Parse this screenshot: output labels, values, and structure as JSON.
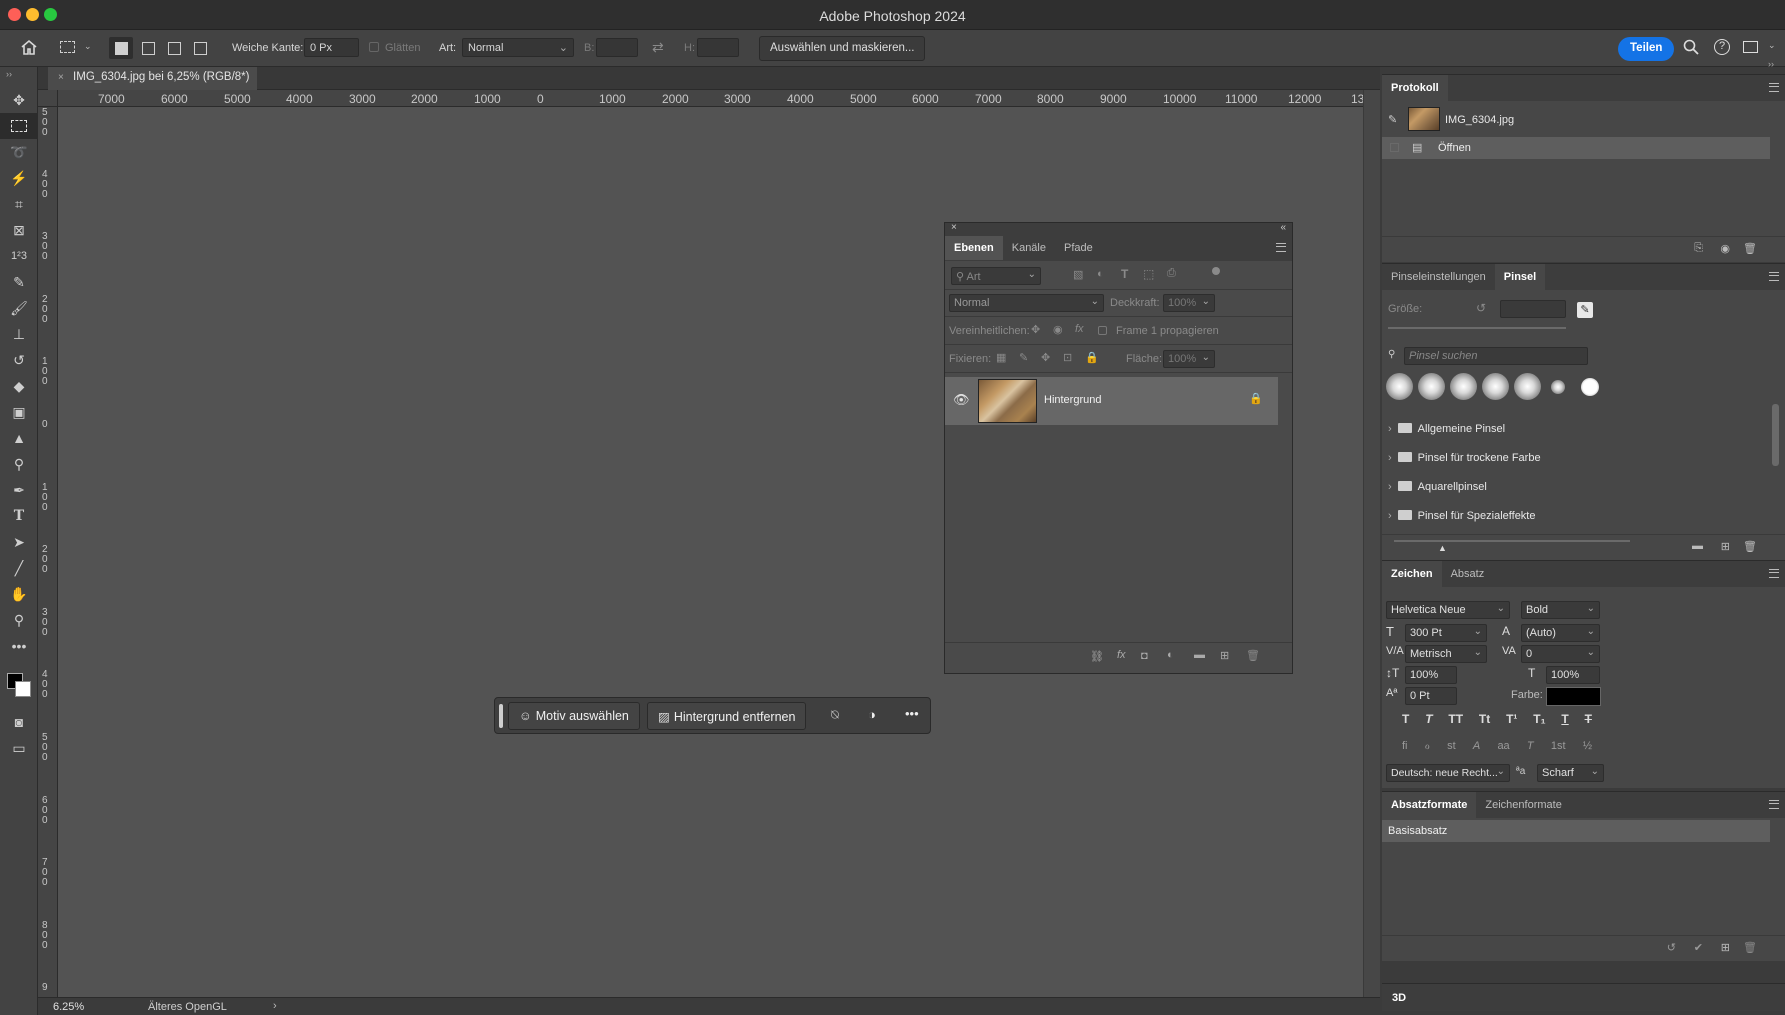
{
  "titlebar": {
    "title": "Adobe Photoshop 2024",
    "close_color": "#fe5f57",
    "minimize_color": "#febc2e",
    "zoom_color": "#28c840"
  },
  "options": {
    "feather_label": "Weiche Kante:",
    "feather_value": "0 Px",
    "antialias_label": "Glätten",
    "style_label": "Art:",
    "style_value": "Normal",
    "width_label": "B:",
    "height_label": "H:",
    "select_mask_button": "Auswählen und maskieren...",
    "share_button": "Teilen"
  },
  "document": {
    "tab_title": "IMG_6304.jpg bei 6,25% (RGB/8*)"
  },
  "ruler_h": [
    "7000",
    "6000",
    "5000",
    "4000",
    "3000",
    "2000",
    "1000",
    "0",
    "1000",
    "2000",
    "3000",
    "4000",
    "5000",
    "6000",
    "7000",
    "8000",
    "9000",
    "10000",
    "11000",
    "12000",
    "13"
  ],
  "ruler_v": [
    "5\n0\n0",
    "4\n0\n0",
    "3\n0\n0",
    "2\n0\n0",
    "1\n0\n0",
    "0",
    "1\n0\n0",
    "2\n0\n0",
    "3\n0\n0",
    "4\n0\n0",
    "5\n0\n0",
    "6\n0\n0",
    "7\n0\n0",
    "8\n0\n0",
    "9"
  ],
  "status": {
    "zoom": "6.25%",
    "info": "Älteres OpenGL"
  },
  "layers_panel": {
    "tabs": [
      "Ebenen",
      "Kanäle",
      "Pfade"
    ],
    "filter_placeholder": "Art",
    "blend_mode": "Normal",
    "opacity_label": "Deckkraft:",
    "opacity_value": "100%",
    "unify_label": "Vereinheitlichen:",
    "propagate_label": "Frame 1 propagieren",
    "lock_label": "Fixieren:",
    "fill_label": "Fläche:",
    "fill_value": "100%",
    "layer_name": "Hintergrund"
  },
  "taskbar": {
    "select_subject": "Motiv auswählen",
    "remove_background": "Hintergrund entfernen"
  },
  "history_panel": {
    "title": "Protokoll",
    "snapshot": "IMG_6304.jpg",
    "state": "Öffnen"
  },
  "brush_panel": {
    "tabs": [
      "Pinseleinstellungen",
      "Pinsel"
    ],
    "size_label": "Größe:",
    "search_placeholder": "Pinsel suchen",
    "groups": [
      "Allgemeine Pinsel",
      "Pinsel für trockene Farbe",
      "Aquarellpinsel",
      "Pinsel für Spezialeffekte"
    ]
  },
  "character_panel": {
    "tabs": [
      "Zeichen",
      "Absatz"
    ],
    "font_family": "Helvetica Neue",
    "font_style": "Bold",
    "font_size": "300 Pt",
    "leading": "(Auto)",
    "kerning": "Metrisch",
    "tracking": "0",
    "vscale": "100%",
    "hscale": "100%",
    "baseline": "0 Pt",
    "color_label": "Farbe:",
    "language": "Deutsch: neue Recht...",
    "antialias_icon_label": "ªa",
    "antialias": "Scharf",
    "style_glyphs": [
      "T",
      "T",
      "TT",
      "Tt",
      "T¹",
      "T₁",
      "T",
      "T"
    ],
    "ot_glyphs": [
      "fi",
      "ℴ",
      "st",
      "A",
      "aa",
      "T",
      "1st",
      "½"
    ]
  },
  "paragraph_styles_panel": {
    "tabs": [
      "Absatzformate",
      "Zeichenformate"
    ],
    "item": "Basisabsatz"
  },
  "bottom_panel": {
    "label": "3D"
  },
  "colors": {
    "share": "#1473e6",
    "canvas": "#535353",
    "panel": "#474747"
  }
}
